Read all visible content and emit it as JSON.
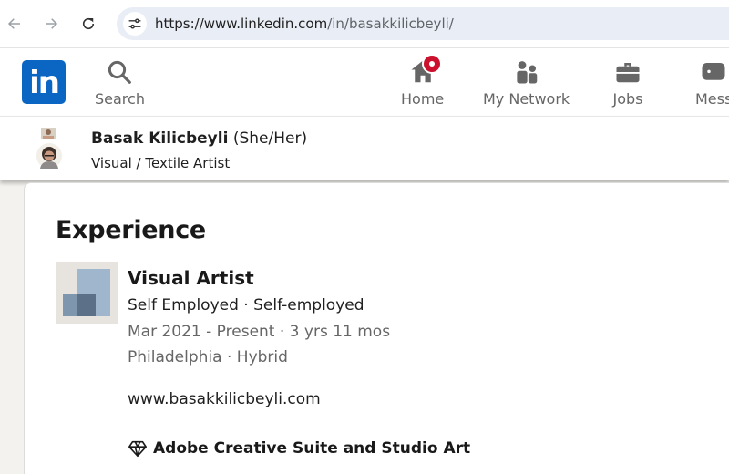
{
  "browser": {
    "url_host": "https://www.linkedin.com",
    "url_path": "/in/basakkilicbeyli/"
  },
  "nav": {
    "logo_text": "in",
    "items": [
      {
        "label": "Search",
        "icon": "search-icon"
      },
      {
        "label": "Home",
        "icon": "home-icon"
      },
      {
        "label": "My Network",
        "icon": "people-icon"
      },
      {
        "label": "Jobs",
        "icon": "briefcase-icon"
      },
      {
        "label": "Mess",
        "icon": "messaging-icon"
      }
    ]
  },
  "profile": {
    "name": "Basak Kilicbeyli",
    "pronouns": "(She/Her)",
    "headline": "Visual / Textile Artist"
  },
  "experience": {
    "section_title": "Experience",
    "title": "Visual Artist",
    "company": "Self Employed · Self-employed",
    "dates": "Mar 2021 - Present · 3 yrs 11 mos",
    "location": "Philadelphia · Hybrid",
    "website": "www.basakkilicbeyli.com",
    "skills": "Adobe Creative Suite and Studio Art"
  },
  "colors": {
    "brand": "#0a66c2",
    "notification": "#cb112d",
    "page_bg": "#f4f2ee"
  }
}
